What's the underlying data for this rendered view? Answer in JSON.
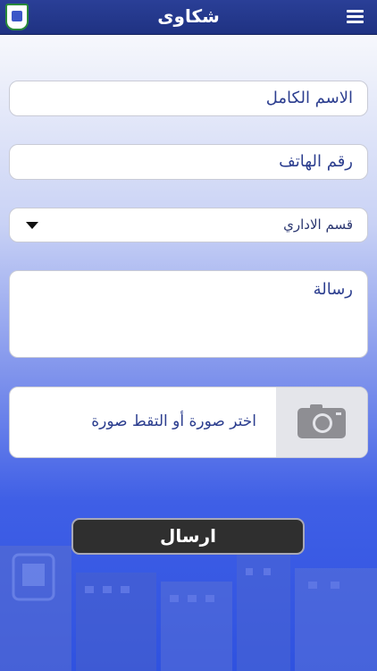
{
  "header": {
    "title": "شكاوى",
    "logo": "school-logo",
    "menu_icon": "hamburger-menu-icon",
    "color": "#22358a"
  },
  "form": {
    "full_name": {
      "placeholder": "الاسم الكامل"
    },
    "phone": {
      "placeholder": "رقم الهاتف"
    },
    "department": {
      "selected": "قسم الاداري"
    },
    "message": {
      "placeholder": "رسالة"
    },
    "photo": {
      "label": "اختر صورة أو التقط صورة",
      "icon": "camera-icon"
    },
    "submit_label": "ارسال"
  },
  "colors": {
    "accent_text": "#2c3e8f",
    "button": "#2f2f2f",
    "background_bottom": "#2f52e0"
  }
}
